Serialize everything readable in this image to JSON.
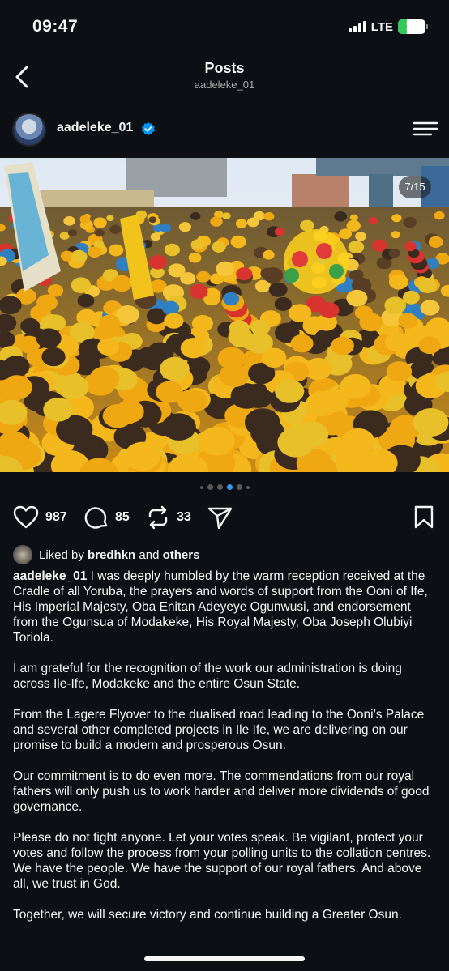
{
  "status_bar": {
    "time": "09:47",
    "network": "LTE",
    "battery": "32",
    "battery_level": 0.32
  },
  "header": {
    "title": "Posts",
    "subtitle": "aadeleke_01"
  },
  "post": {
    "username": "aadeleke_01",
    "page_indicator": "7/15",
    "carousel": {
      "total_dots": 6,
      "active_dot": 4
    },
    "likes": "987",
    "comments": "85",
    "reposts": "33",
    "liked_by_prefix": "Liked by",
    "liked_by_user": "bredhkn",
    "liked_by_and": "and",
    "liked_by_others": "others",
    "caption_user": "aadeleke_01",
    "caption_paragraphs": [
      "I was deeply humbled by the warm reception received at the Cradle of all Yoruba, the prayers and words of support from the Ooni of Ife, His Imperial Majesty, Oba Enitan Adeyeye Ogunwusi, and endorsement from the Ogunsua of Modakeke, His Royal Majesty, Oba Joseph Olubiyi Toriola.",
      "I am grateful for the recognition of the work our administration is doing across Ile-Ife, Modakeke and the entire Osun State.",
      "From the Lagere Flyover to the dualised road leading to the Ooni’s Palace and several other completed projects in Ile Ife, we are delivering on our promise to build a modern and prosperous Osun.",
      "Our commitment is to do even more. The commendations from our royal fathers will only push us to work harder and deliver more dividends of good governance.",
      "Please do not fight anyone. Let your votes speak. Be vigilant, protect your votes and follow the process from your polling units to the collation centres. We have the people. We have the support of our royal fathers. And above all, we trust in God.",
      "Together, we will secure victory and continue building a Greater Osun."
    ]
  },
  "colors": {
    "background": "#0c1014",
    "verified": "#0095f6",
    "accent_yellow": "#f2b31a",
    "battery_green": "#34c759"
  }
}
